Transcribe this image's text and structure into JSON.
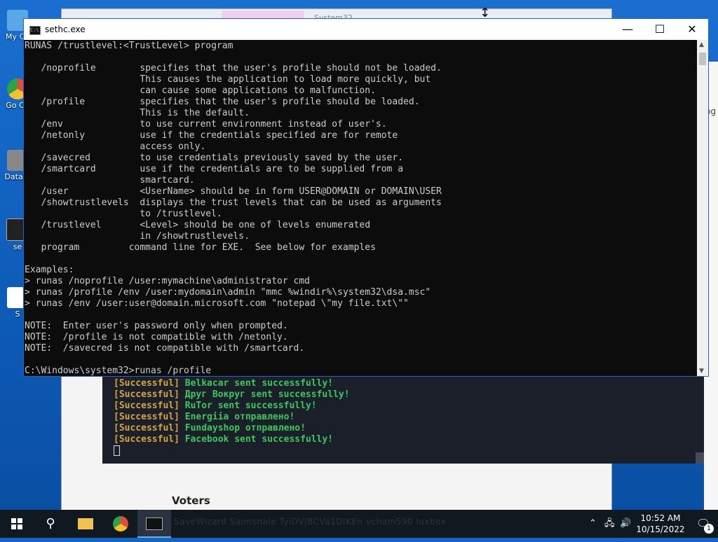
{
  "desktop": {
    "icons": [
      {
        "label": "My Co",
        "color": "#5aa9e6"
      },
      {
        "label": "Go Ch",
        "color": "#e24a3b"
      },
      {
        "label": "DataW",
        "color": "#888888"
      },
      {
        "label": "se",
        "color": "#222222"
      },
      {
        "label": "S",
        "color": "#ffffff"
      }
    ]
  },
  "background_window": {
    "tab_title": "System32",
    "side_text": "og",
    "voters_heading": "Voters",
    "terminal_lines": [
      {
        "tag": "[Successful]",
        "msg": "Belkacar sent successfully!"
      },
      {
        "tag": "[Successful]",
        "msg": "Друг Вокруг sent successfully!"
      },
      {
        "tag": "[Successful]",
        "msg": "RuTor sent successfully!"
      },
      {
        "tag": "[Successful]",
        "msg": "Energiia отправлено!"
      },
      {
        "tag": "[Successful]",
        "msg": "Fundayshop отправлено!"
      },
      {
        "tag": "[Successful]",
        "msg": "Facebook sent successfully!"
      }
    ]
  },
  "cmd_window": {
    "title": "sethc.exe",
    "icon_text": "C:\\",
    "buttons": {
      "minimize": "—",
      "maximize": "☐",
      "close": "✕"
    },
    "lines": [
      "RUNAS /trustlevel:<TrustLevel> program",
      "",
      "   /noprofile        specifies that the user's profile should not be loaded.",
      "                     This causes the application to load more quickly, but",
      "                     can cause some applications to malfunction.",
      "   /profile          specifies that the user's profile should be loaded.",
      "                     This is the default.",
      "   /env              to use current environment instead of user's.",
      "   /netonly          use if the credentials specified are for remote",
      "                     access only.",
      "   /savecred         to use credentials previously saved by the user.",
      "   /smartcard        use if the credentials are to be supplied from a",
      "                     smartcard.",
      "   /user             <UserName> should be in form USER@DOMAIN or DOMAIN\\USER",
      "   /showtrustlevels  displays the trust levels that can be used as arguments",
      "                     to /trustlevel.",
      "   /trustlevel       <Level> should be one of levels enumerated",
      "                     in /showtrustlevels.",
      "   program         command line for EXE.  See below for examples",
      "",
      "Examples:",
      "> runas /noprofile /user:mymachine\\administrator cmd",
      "> runas /profile /env /user:mydomain\\admin \"mmc %windir%\\system32\\dsa.msc\"",
      "> runas /env /user:user@domain.microsoft.com \"notepad \\\"my file.txt\\\"\"",
      "",
      "NOTE:  Enter user's password only when prompted.",
      "NOTE:  /profile is not compatible with /netonly.",
      "NOTE:  /savecred is not compatible with /smartcard.",
      "",
      "C:\\Windows\\system32>runas /profile"
    ]
  },
  "taskbar": {
    "search_icon": "⚲",
    "background_text": "SaveWizard   Saimsnale   TyiDVJBCVa1DIKEn   vcham590   luxbox",
    "clock_time": "10:52 AM",
    "clock_date": "10/15/2022",
    "notification_count": "1"
  }
}
